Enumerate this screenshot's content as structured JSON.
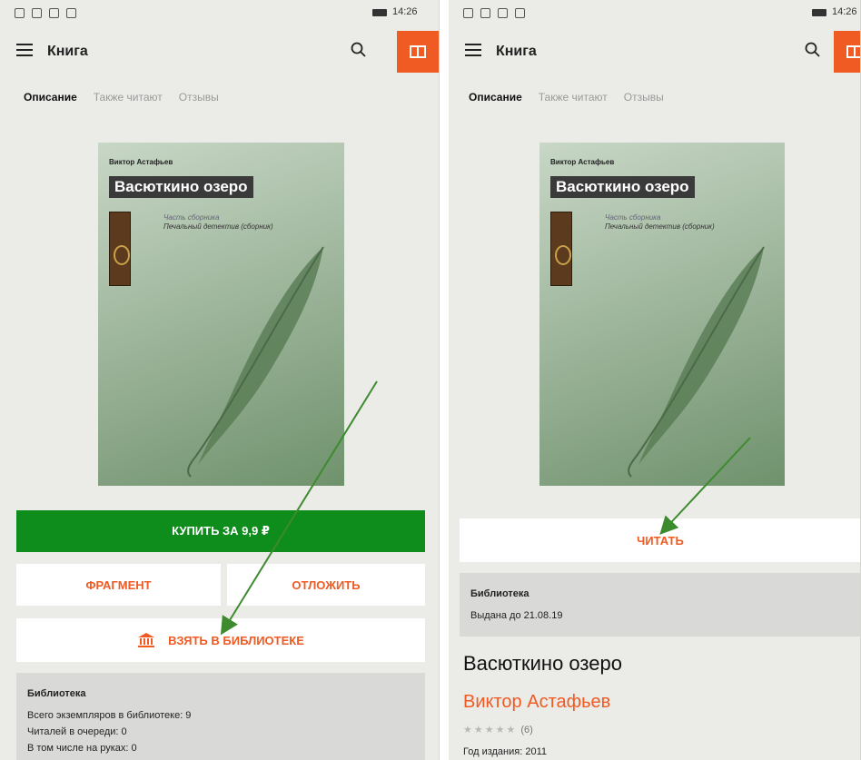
{
  "status_bar": {
    "time": "14:26"
  },
  "app_bar": {
    "title": "Книга"
  },
  "tabs": [
    {
      "label": "Описание",
      "active": true
    },
    {
      "label": "Также читают",
      "active": false
    },
    {
      "label": "Отзывы",
      "active": false
    }
  ],
  "cover": {
    "author": "Виктор Астафьев",
    "title": "Васюткино озеро",
    "series_label": "Часть сборника",
    "series_name": "Печальный детектив (сборник)"
  },
  "left_screen": {
    "buy_label": "КУПИТЬ ЗА 9,9 ₽",
    "fragment_label": "ФРАГМЕНТ",
    "postpone_label": "ОТЛОЖИТЬ",
    "borrow_label": "ВЗЯТЬ В БИБЛИОТЕКЕ",
    "library": {
      "title": "Библиотека",
      "lines": [
        "Всего экземпляров в библиотеке: 9",
        "Читалей в очереди: 0",
        "В том числе на руках: 0"
      ]
    }
  },
  "right_screen": {
    "read_label": "ЧИТАТЬ",
    "library": {
      "title": "Библиотека",
      "issued": "Выдана до 21.08.19"
    },
    "book_title": "Васюткино озеро",
    "book_author": "Виктор Астафьев",
    "rating_count": "(6)",
    "year_line": "Год издания: 2011"
  },
  "colors": {
    "accent": "#f05a23",
    "buy_green": "#0e8c1c",
    "arrow_green": "#3d8b2f"
  }
}
